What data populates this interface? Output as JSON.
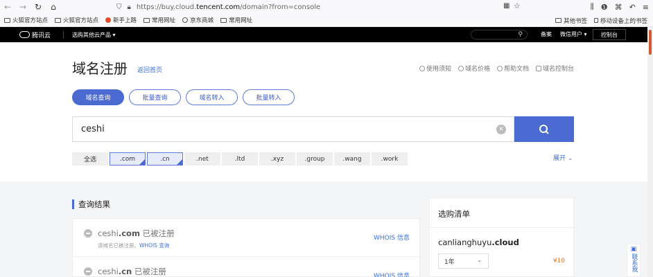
{
  "browser": {
    "url_prefix": "https://buy.cloud.",
    "url_domain": "tencent.com",
    "url_suffix": "/domain?from=console",
    "bookmarks": [
      "火狐官方站点",
      "火狐官方站点",
      "新手上路",
      "常用网址",
      "京东商城",
      "常用网址"
    ],
    "other_bookmarks": "其他书签",
    "mobile_bookmarks": "移动设备上的书签"
  },
  "topnav": {
    "logo": "腾讯云",
    "menu": "选购其他云产品 ▾",
    "beian": "备案",
    "user": "微信用户 ▾",
    "console": "控制台"
  },
  "header": {
    "title": "域名注册",
    "back_link": "返回首页",
    "util_links": [
      "使用须知",
      "域名价格",
      "帮助文档",
      "域名控制台"
    ]
  },
  "tabs": [
    {
      "label": "域名查询",
      "active": true
    },
    {
      "label": "批量查询",
      "active": false
    },
    {
      "label": "域名转入",
      "active": false
    },
    {
      "label": "批量转入",
      "active": false
    }
  ],
  "search": {
    "value": "ceshi"
  },
  "suffixes": [
    {
      "label": "全选",
      "selected": false
    },
    {
      "label": ".com",
      "selected": true
    },
    {
      "label": ".cn",
      "selected": true
    },
    {
      "label": ".net",
      "selected": false
    },
    {
      "label": ".ltd",
      "selected": false
    },
    {
      "label": ".xyz",
      "selected": false
    },
    {
      "label": ".group",
      "selected": false
    },
    {
      "label": ".wang",
      "selected": false
    },
    {
      "label": ".work",
      "selected": false
    }
  ],
  "expand_label": "展开",
  "results": {
    "title": "查询结果",
    "items": [
      {
        "name": "ceshi",
        "tld": ".com",
        "status": "已被注册",
        "sub_text": "该域名已被注册。",
        "sub_link": "WHOIS 查询",
        "whois": "WHOIS 信息"
      },
      {
        "name": "ceshi",
        "tld": ".cn",
        "status": "已被注册",
        "whois": "WHOIS 信息"
      }
    ]
  },
  "cart": {
    "title": "选购清单",
    "domain_name": "canlianghuyu",
    "domain_tld": ".cloud",
    "period": "1年",
    "price": "¥10"
  },
  "float_help": "联系我"
}
